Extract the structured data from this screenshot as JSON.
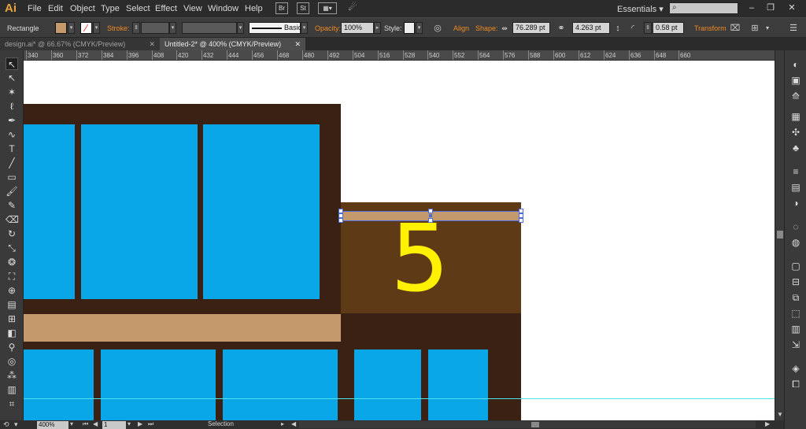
{
  "app": {
    "logo": "Ai"
  },
  "menu": [
    "File",
    "Edit",
    "Object",
    "Type",
    "Select",
    "Effect",
    "View",
    "Window",
    "Help"
  ],
  "menubar_icons": {
    "bridge": "Br",
    "stock": "St"
  },
  "workspace": {
    "label": "Essentials",
    "arrow": "▾"
  },
  "window_controls": {
    "minimize": "–",
    "restore": "❐",
    "close": "✕"
  },
  "control": {
    "selection_type": "Rectangle",
    "fill_color": "#c49a6c",
    "stroke_label": "Stroke:",
    "stroke_style": "Basic",
    "opacity_label": "Opacity:",
    "opacity_value": "100%",
    "style_label": "Style:",
    "align_label": "Align",
    "shape_label": "Shape:",
    "width_value": "76.289 pt",
    "height_value": "4.263 pt",
    "corner_value": "0.58 pt",
    "transform_label": "Transform"
  },
  "tabs": [
    {
      "label": "design.ai* @ 66.67% (CMYK/Preview)",
      "close": "✕",
      "active": false
    },
    {
      "label": "Untitled-2* @ 400% (CMYK/Preview)",
      "close": "✕",
      "active": true
    }
  ],
  "ruler_ticks": [
    "340",
    "360",
    "372",
    "384",
    "396",
    "408",
    "420",
    "432",
    "444",
    "456",
    "468",
    "480",
    "492",
    "504",
    "516",
    "528",
    "540",
    "552",
    "564",
    "576",
    "588",
    "600",
    "612",
    "624",
    "636",
    "648",
    "660"
  ],
  "canvas": {
    "number_text": "5",
    "colors": {
      "dark_brown": "#3b2113",
      "medium_brown": "#5f3a17",
      "tan": "#c49a6c",
      "blue": "#09a7e8",
      "yellow": "#fff100",
      "guide": "#4fe3ef"
    }
  },
  "status": {
    "zoom": "400%",
    "artboard": "1",
    "tool": "Selection"
  }
}
